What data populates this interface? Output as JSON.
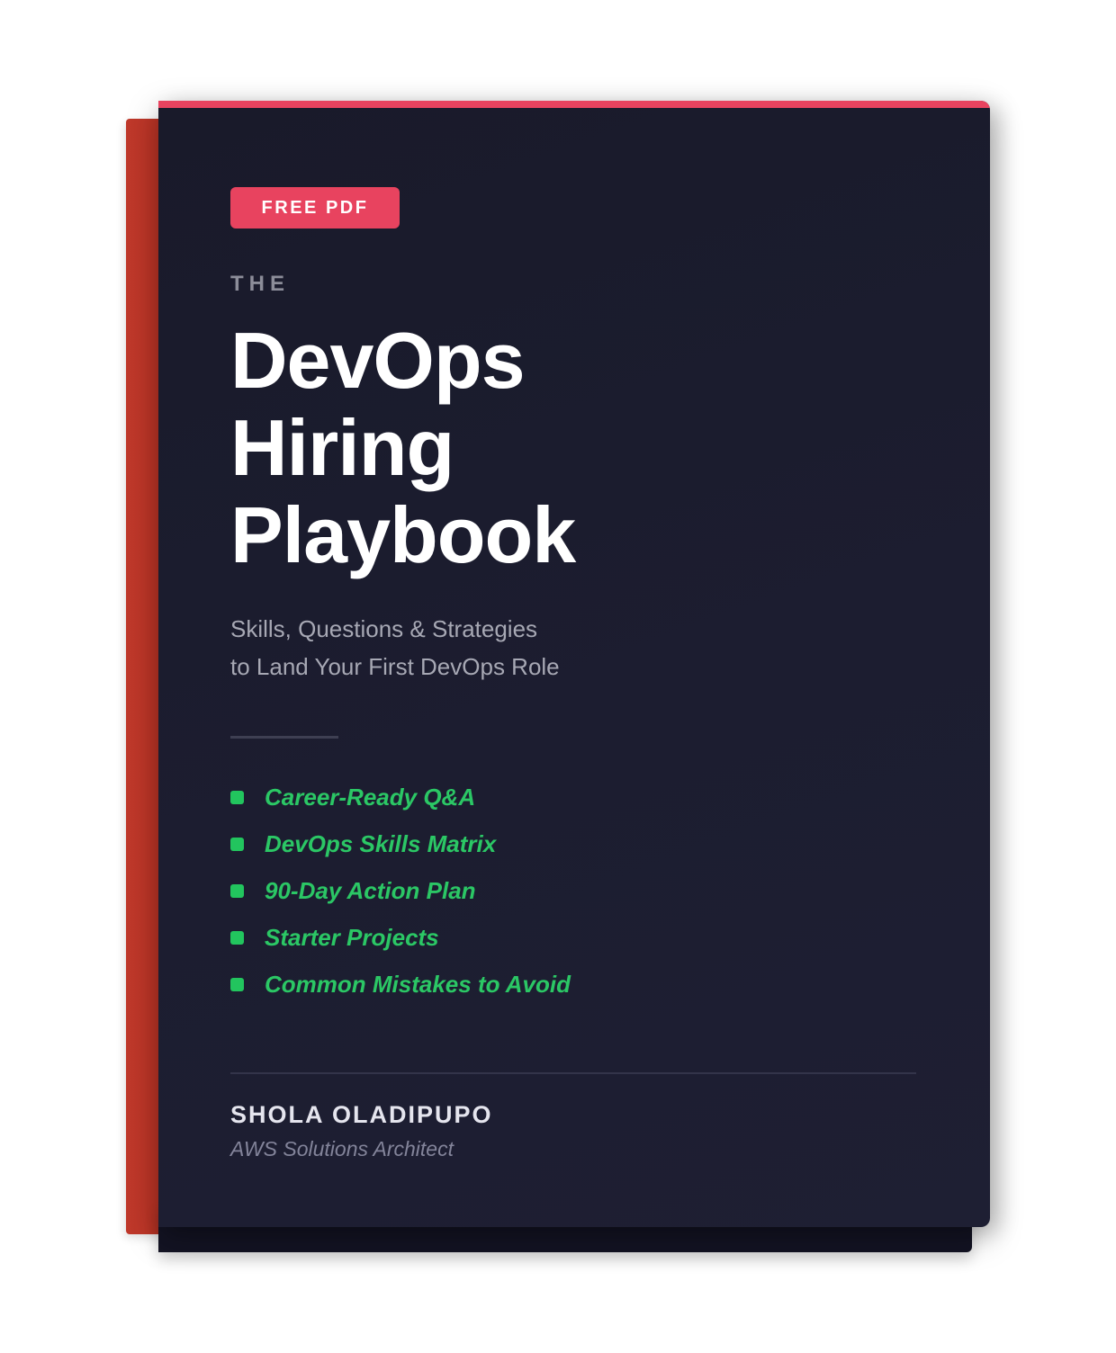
{
  "badge": "FREE PDF",
  "eyebrow": "THE",
  "title": {
    "line1": "DevOps",
    "line2": "Hiring",
    "line3": "Playbook"
  },
  "subtitle": {
    "line1": "Skills, Questions & Strategies",
    "line2": "to Land Your First DevOps Role"
  },
  "features": [
    "Career-Ready Q&A",
    "DevOps Skills Matrix",
    "90-Day Action Plan",
    "Starter Projects",
    "Common Mistakes to Avoid"
  ],
  "author": {
    "name": "SHOLA OLADIPUPO",
    "role": "AWS Solutions Architect"
  },
  "colors": {
    "accent": "#e8435f",
    "spine": "#c0392b",
    "cover": "#1c1d30",
    "feature_green": "#2bc765"
  }
}
